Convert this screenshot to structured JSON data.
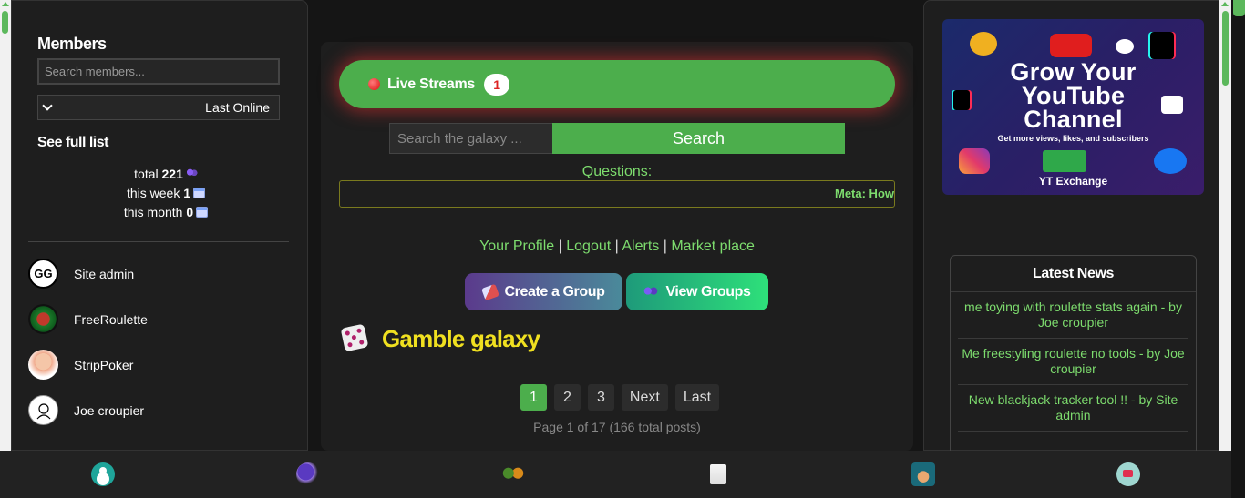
{
  "members_panel": {
    "title": "Members",
    "search_placeholder": "Search members...",
    "sort_selected": "Last Online",
    "full_list_label": "See full list",
    "stats": {
      "total_label": "total",
      "total_value": "221",
      "week_label": "this week",
      "week_value": "1",
      "month_label": "this month",
      "month_value": "0"
    },
    "members": [
      {
        "name": "Site admin",
        "avatar_text": "GG"
      },
      {
        "name": "FreeRoulette"
      },
      {
        "name": "StripPoker"
      },
      {
        "name": "Joe croupier"
      }
    ]
  },
  "main": {
    "live_streams_label": "Live Streams",
    "live_streams_count": "1",
    "search_placeholder": "Search the galaxy ...",
    "search_button": "Search",
    "questions_label": "Questions:",
    "ticker_text": "Meta: How",
    "links": {
      "profile": "Your Profile",
      "logout": "Logout",
      "alerts": "Alerts",
      "market": "Market place",
      "separator": "|"
    },
    "create_group": "Create a Group",
    "view_groups": "View Groups",
    "group_title": "Gamble galaxy",
    "pagination": [
      "1",
      "2",
      "3",
      "Next",
      "Last"
    ],
    "active_page": "1",
    "page_info": "Page 1 of 17 (166 total posts)"
  },
  "ad": {
    "headline_1": "Grow Your",
    "headline_2": "YouTube",
    "headline_3": "Channel",
    "subtext": "Get more views, likes, and subscribers",
    "brand": "YT Exchange"
  },
  "news": {
    "title": "Latest News",
    "items": [
      "me toying with roulette stats again - by Joe croupier",
      "Me freestyling roulette no tools - by Joe croupier",
      "New blackjack tracker tool !! - by Site admin"
    ]
  },
  "bottom_nav": [
    "profile-icon",
    "search-icon",
    "members-icon",
    "posts-icon",
    "deals-icon",
    "cart-icon"
  ]
}
